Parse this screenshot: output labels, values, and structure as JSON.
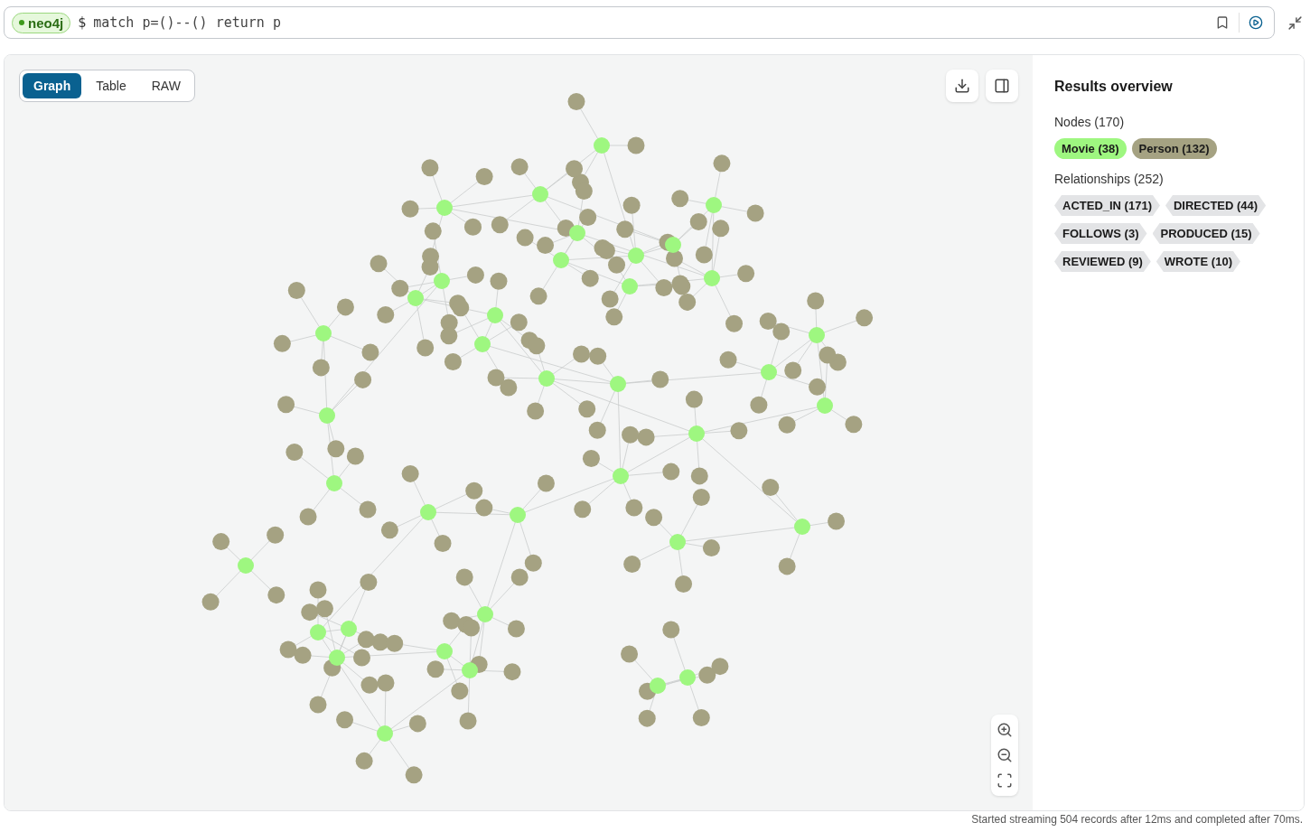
{
  "query_bar": {
    "connection": "neo4j",
    "connected": true,
    "prompt": "$",
    "query": "match p=()--() return p"
  },
  "view_tabs": [
    {
      "label": "Graph",
      "selected": true
    },
    {
      "label": "Table",
      "selected": false
    },
    {
      "label": "RAW",
      "selected": false
    }
  ],
  "results_overview": {
    "title": "Results overview",
    "nodes_heading": "Nodes (170)",
    "node_labels": [
      {
        "label": "Movie (38)",
        "color": "#9ef780"
      },
      {
        "label": "Person (132)",
        "color": "#a5a282"
      }
    ],
    "relationships_heading": "Relationships (252)",
    "relationship_types": [
      "ACTED_IN (171)",
      "DIRECTED (44)",
      "FOLLOWS (3)",
      "PRODUCED (15)",
      "REVIEWED (9)",
      "WROTE (10)"
    ]
  },
  "status_bar": "Started streaming 504 records after 12ms and completed after 70ms."
}
